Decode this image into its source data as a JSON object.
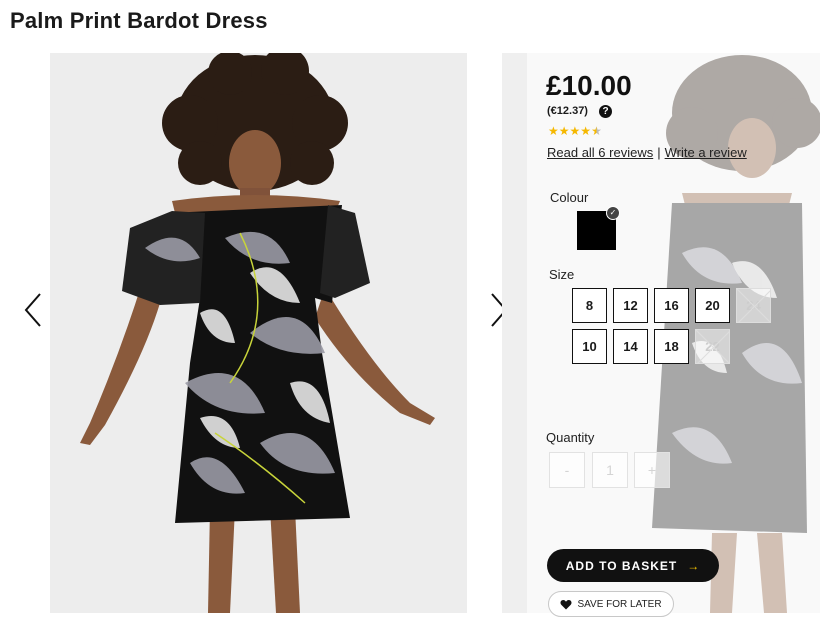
{
  "product": {
    "title": "Palm Print Bardot Dress",
    "price": "£10.00",
    "price_eur": "(€12.37)",
    "rating": 4.5,
    "rating_max": 5,
    "reviews_link": "Read all 6 reviews",
    "separator": "|",
    "write_review": "Write a review"
  },
  "colour": {
    "label": "Colour",
    "selected": "black",
    "swatch_color": "#000000"
  },
  "size": {
    "label": "Size",
    "options": [
      {
        "value": "8",
        "available": true
      },
      {
        "value": "12",
        "available": true
      },
      {
        "value": "16",
        "available": true
      },
      {
        "value": "20",
        "available": true
      },
      {
        "value": "24",
        "available": false
      },
      {
        "value": "10",
        "available": true
      },
      {
        "value": "14",
        "available": true
      },
      {
        "value": "18",
        "available": true
      },
      {
        "value": "22",
        "available": false
      }
    ]
  },
  "quantity": {
    "label": "Quantity",
    "minus": "-",
    "value": "1",
    "plus": "+"
  },
  "actions": {
    "add_to_basket": "ADD TO BASKET",
    "save_for_later": "SAVE FOR LATER"
  },
  "icons": {
    "prev": "chevron-left-icon",
    "next": "chevron-right-icon",
    "help": "question-circle-icon",
    "heart": "heart-icon",
    "arrow": "arrow-right-icon"
  },
  "colors": {
    "star": "#f5b800",
    "button": "#111111",
    "arrow_accent": "#f5c400"
  }
}
